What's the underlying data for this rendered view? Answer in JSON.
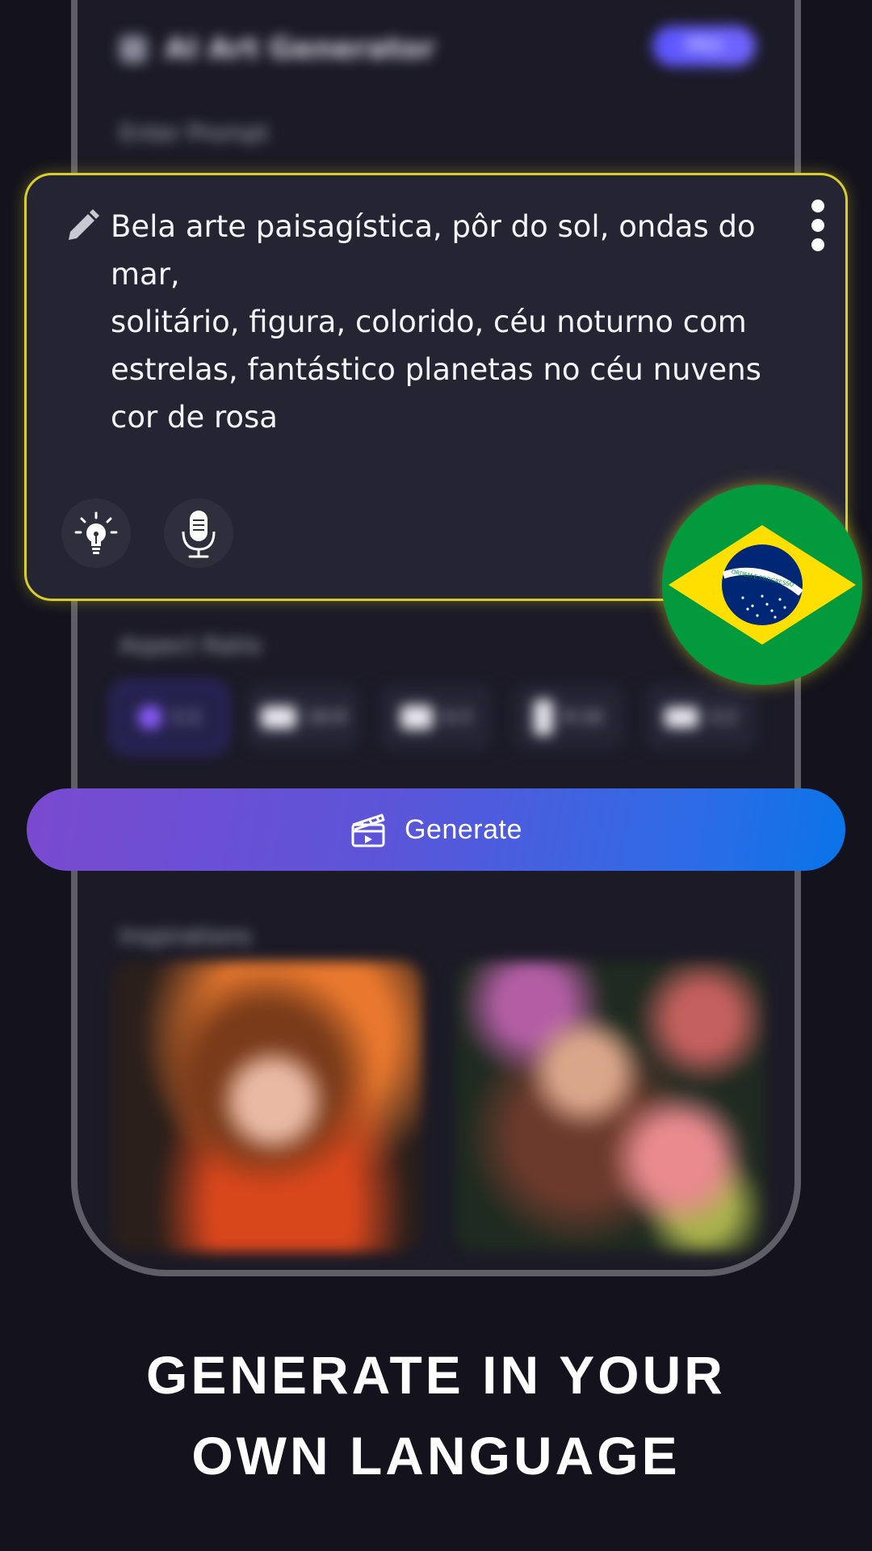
{
  "background_app": {
    "title": "AI Art Generator",
    "pro_badge": "PRO",
    "prompt_section_label": "Enter Prompt",
    "aspect_ratio_label": "Aspect Ratio",
    "aspect_ratios": [
      "1:1",
      "16:9",
      "4:3",
      "9:16",
      "3:2"
    ],
    "inspirations_label": "Inspirations"
  },
  "prompt": {
    "lines": [
      "Bela arte paisagística, pôr do sol, ondas do mar,",
      "solitário, figura, colorido, céu noturno com",
      "estrelas, fantástico planetas no céu nuvens",
      "cor de rosa"
    ]
  },
  "flag": {
    "motto": "ORDEM E PROGRESSO",
    "colors": {
      "green": "#039a3e",
      "yellow": "#fedf00",
      "blue": "#002776"
    }
  },
  "generate_button": {
    "label": "Generate"
  },
  "headline": {
    "line1": "GENERATE IN YOUR",
    "line2": "OWN LANGUAGE"
  },
  "colors": {
    "background": "#14131d",
    "card": "#252433",
    "card_border": "#d8cd2a",
    "button_gradient_start": "#7a4ad0",
    "button_gradient_end": "#0a74e8"
  },
  "icons": [
    "pencil-icon",
    "more-vertical-icon",
    "lightbulb-icon",
    "microphone-icon",
    "clapperboard-icon",
    "brazil-flag-icon"
  ]
}
